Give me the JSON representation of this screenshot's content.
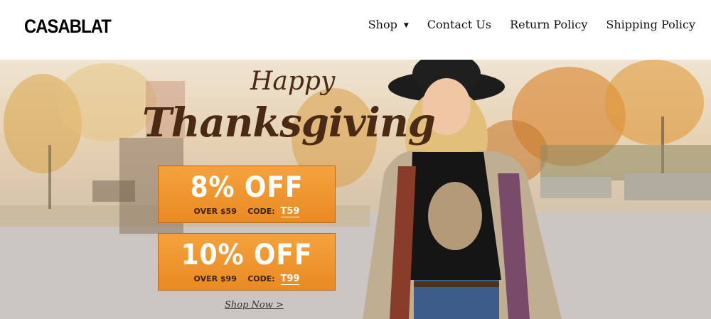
{
  "header": {
    "logo": "CASABLAT",
    "nav": [
      {
        "label": "Shop",
        "has_dropdown": true
      },
      {
        "label": "Contact Us"
      },
      {
        "label": "Return Policy"
      },
      {
        "label": "Shipping Policy"
      }
    ]
  },
  "banner": {
    "happy": "Happy",
    "thanksgiving": "Thanksgiving",
    "offers": [
      {
        "headline": "8% OFF",
        "condition": "OVER $59",
        "code_label": "CODE:",
        "code": "T59"
      },
      {
        "headline": "10% OFF",
        "condition": "OVER $99",
        "code_label": "CODE:",
        "code": "T99"
      }
    ],
    "cta": "Shop Now >"
  },
  "colors": {
    "offer_orange": "#ef9530",
    "script_brown": "#4a2a14"
  }
}
